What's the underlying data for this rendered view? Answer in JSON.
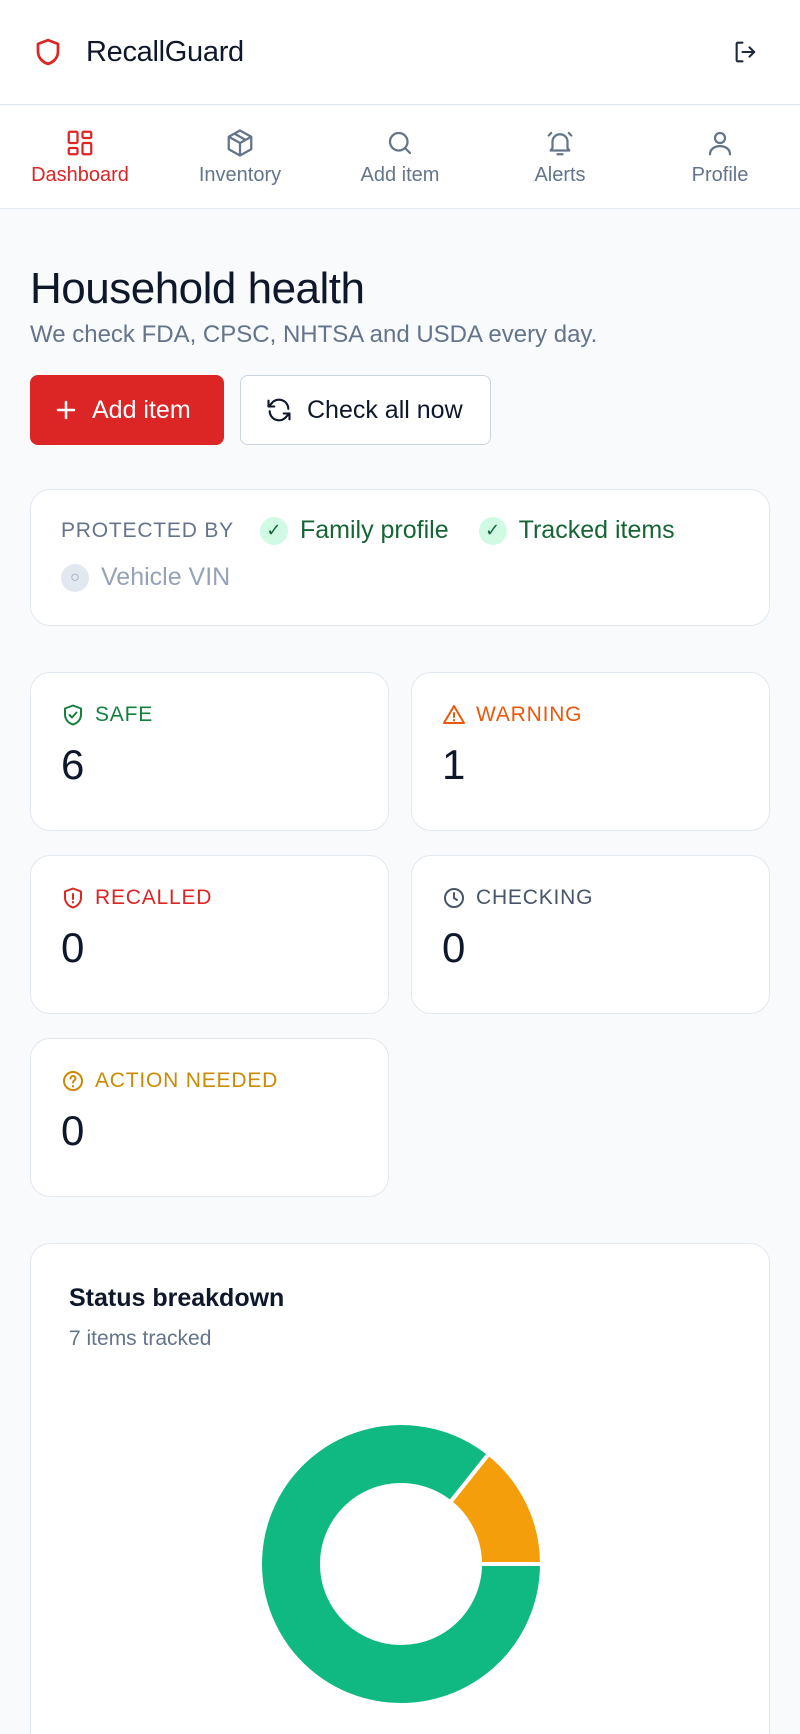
{
  "app": {
    "name": "RecallGuard"
  },
  "nav": {
    "items": [
      {
        "label": "Dashboard",
        "icon": "dashboard-icon",
        "active": true
      },
      {
        "label": "Inventory",
        "icon": "box-icon",
        "active": false
      },
      {
        "label": "Add item",
        "icon": "search-icon",
        "active": false
      },
      {
        "label": "Alerts",
        "icon": "bell-icon",
        "active": false
      },
      {
        "label": "Profile",
        "icon": "user-icon",
        "active": false
      }
    ]
  },
  "page": {
    "title": "Household health",
    "subtitle": "We check FDA, CPSC, NHTSA and USDA every day."
  },
  "actions": {
    "add_label": "Add item",
    "check_label": "Check all now"
  },
  "protected": {
    "label": "PROTECTED BY",
    "items": [
      {
        "label": "Family profile",
        "enabled": true,
        "mark": "✓"
      },
      {
        "label": "Tracked items",
        "enabled": true,
        "mark": "✓"
      },
      {
        "label": "Vehicle VIN",
        "enabled": false,
        "mark": "○"
      }
    ]
  },
  "stats": {
    "safe": {
      "label": "SAFE",
      "value": "6",
      "color": "#15803d"
    },
    "warning": {
      "label": "WARNING",
      "value": "1",
      "color": "#ea580c"
    },
    "recalled": {
      "label": "RECALLED",
      "value": "0",
      "color": "#dc2626"
    },
    "checking": {
      "label": "CHECKING",
      "value": "0",
      "color": "#475569"
    },
    "action": {
      "label": "ACTION NEEDED",
      "value": "0",
      "color": "#ca8a04"
    }
  },
  "breakdown": {
    "title": "Status breakdown",
    "subtitle": "7 items tracked"
  },
  "chart_data": {
    "type": "pie",
    "categories": [
      "Safe",
      "Warning"
    ],
    "values": [
      6,
      1
    ],
    "colors": [
      "#10b981",
      "#f59e0b"
    ],
    "title": "Status breakdown"
  }
}
